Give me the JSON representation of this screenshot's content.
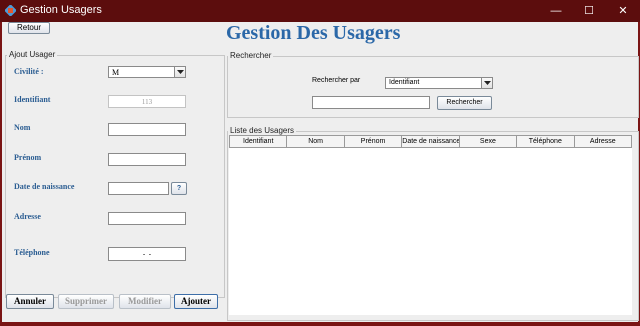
{
  "window": {
    "title": "Gestion Usagers",
    "title_bar_color": "#5c0d0d",
    "accent_color": "#2b68a8"
  },
  "header": {
    "back_label": "Retour",
    "main_title": "Gestion Des Usagers"
  },
  "ajout": {
    "legend": "Ajout Usager",
    "labels": {
      "civilite": "Civilité :",
      "identifiant": "Identifiant",
      "nom": "Nom",
      "prenom": "Prénom",
      "date_naissance": "Date de naissance",
      "adresse": "Adresse",
      "telephone": "Téléphone"
    },
    "values": {
      "civilite": "M",
      "identifiant": "113",
      "nom": "",
      "prenom": "",
      "date_naissance": "",
      "adresse": "",
      "telephone": "  -  -  "
    },
    "date_picker_label": "?"
  },
  "actions": {
    "annuler": "Annuler",
    "supprimer": "Supprimer",
    "modifier": "Modifier",
    "ajouter": "Ajouter"
  },
  "recherche": {
    "legend": "Rechercher",
    "by_label": "Rechercher par",
    "by_value": "Identifiant",
    "query": "",
    "button": "Rechercher"
  },
  "liste": {
    "legend": "Liste des Usagers",
    "columns": [
      "Identifiant",
      "Nom",
      "Prénom",
      "Date de naissance",
      "Sexe",
      "Téléphone",
      "Adresse"
    ]
  }
}
